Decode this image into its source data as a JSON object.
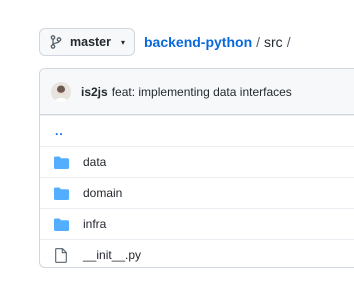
{
  "branch": {
    "label": "master",
    "icon": "git-branch-icon",
    "caret": "▾"
  },
  "breadcrumb": {
    "repo": "backend-python",
    "separator": "/",
    "dir": "src",
    "trailing": "/"
  },
  "commit": {
    "author": "is2js",
    "message": "feat: implementing data interfaces",
    "avatar": "avatar-icon"
  },
  "parent_link": "..",
  "files": [
    {
      "name": "data",
      "type": "folder",
      "icon": "folder-icon"
    },
    {
      "name": "domain",
      "type": "folder",
      "icon": "folder-icon"
    },
    {
      "name": "infra",
      "type": "folder",
      "icon": "folder-icon"
    },
    {
      "name": "__init__.py",
      "type": "file",
      "icon": "file-icon"
    }
  ],
  "colors": {
    "link": "#0969da",
    "folder": "#54aeff",
    "border": "#d0d7de",
    "header_bg": "#f6f8fa"
  }
}
